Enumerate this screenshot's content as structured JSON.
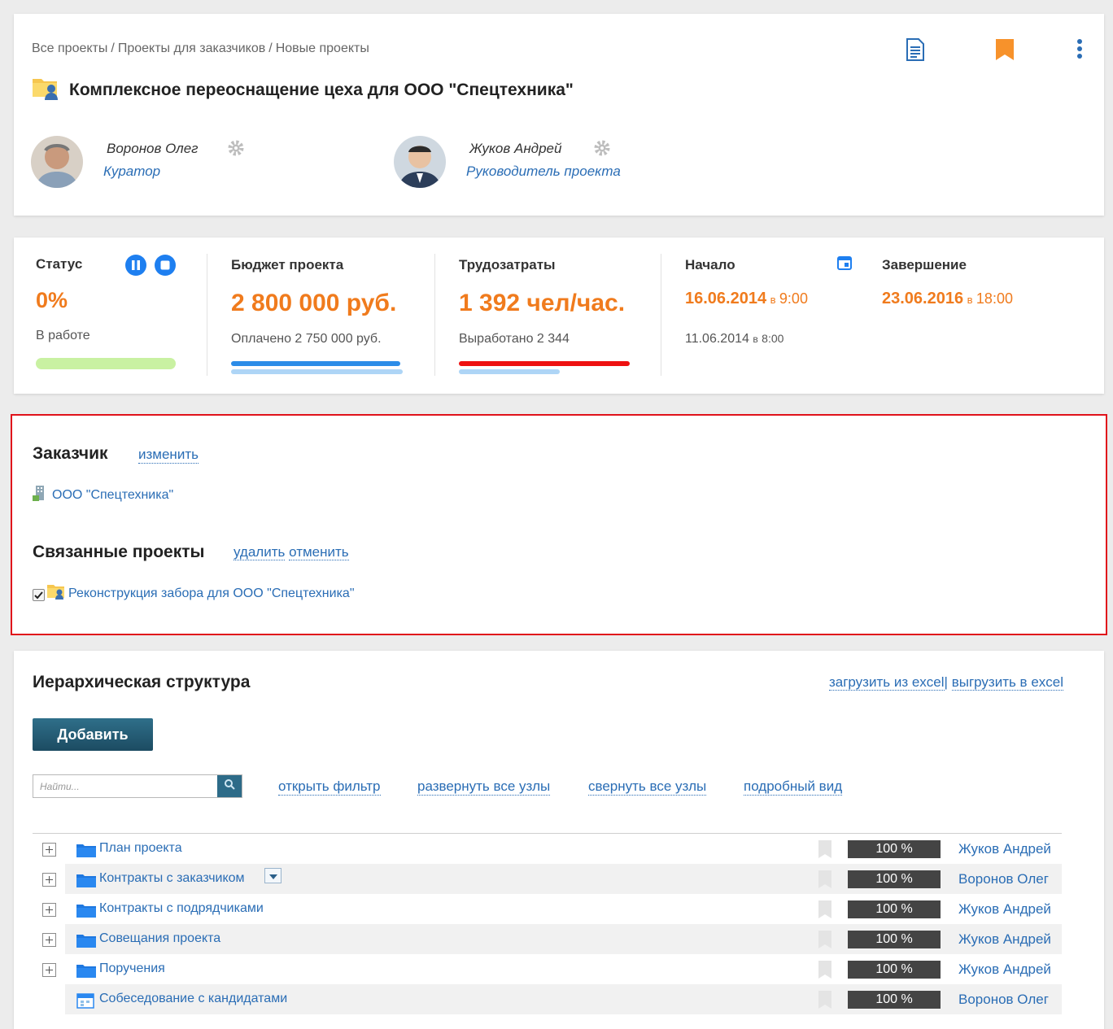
{
  "header": {
    "breadcrumbs": [
      "Все проекты",
      "Проекты для заказчиков",
      "Новые проекты"
    ],
    "breadcrumb_sep": "/",
    "title": "Комплексное переоснащение цеха для ООО \"Спецтехника\"",
    "people": [
      {
        "name": "Воронов Олег",
        "role": "Куратор"
      },
      {
        "name": "Жуков Андрей",
        "role": "Руководитель проекта"
      }
    ]
  },
  "stats": {
    "status": {
      "label": "Статус",
      "value": "0%",
      "state": "В работе",
      "progress": 0
    },
    "budget": {
      "label": "Бюджет проекта",
      "value": "2 800 000 руб.",
      "paid": "Оплачено 2 750 000 руб."
    },
    "labor": {
      "label": "Трудозатраты",
      "value": "1 392 чел/час.",
      "worked": "Выработано 2 344"
    },
    "start": {
      "label": "Начало",
      "date": "16.06.2014",
      "in": "в",
      "time": "9:00",
      "actual_date": "11.06.2014",
      "actual_time": "8:00"
    },
    "end": {
      "label": "Завершение",
      "date": "23.06.2016",
      "in": "в",
      "time": "18:00"
    }
  },
  "customer": {
    "title": "Заказчик",
    "change": "изменить",
    "name": "ООО \"Спецтехника\"",
    "related_title": "Связанные проекты",
    "delete": "удалить",
    "cancel": "отменить",
    "related_item": "Реконструкция забора для ООО \"Спецтехника\""
  },
  "hierarchy": {
    "title": "Иерархическая структура",
    "load_excel": "загрузить из excel",
    "sep": "|",
    "export_excel": "выгрузить в excel",
    "add": "Добавить",
    "search_placeholder": "Найти...",
    "links": [
      "открыть фильтр",
      "развернуть все узлы",
      "свернуть все узлы",
      "подробный вид"
    ],
    "rows": [
      {
        "name": "План проекта",
        "pct": "100 %",
        "owner": "Жуков Андрей",
        "type": "folder",
        "expand": true
      },
      {
        "name": "Контракты с заказчиком",
        "pct": "100 %",
        "owner": "Воронов Олег",
        "type": "folder",
        "expand": true
      },
      {
        "name": "Контракты с подрядчиками",
        "pct": "100 %",
        "owner": "Жуков Андрей",
        "type": "folder",
        "expand": true
      },
      {
        "name": "Совещания проекта",
        "pct": "100 %",
        "owner": "Жуков Андрей",
        "type": "folder",
        "expand": true
      },
      {
        "name": "Поручения",
        "pct": "100 %",
        "owner": "Жуков Андрей",
        "type": "folder",
        "expand": true
      },
      {
        "name": "Собеседование с кандидатами",
        "pct": "100 %",
        "owner": "Воронов Олег",
        "type": "meeting",
        "expand": false
      }
    ]
  },
  "colors": {
    "accent": "#f07b1d",
    "link": "#2a6db5",
    "highlight_border": "#e0121b",
    "status_blue": "#1e7ff0"
  }
}
